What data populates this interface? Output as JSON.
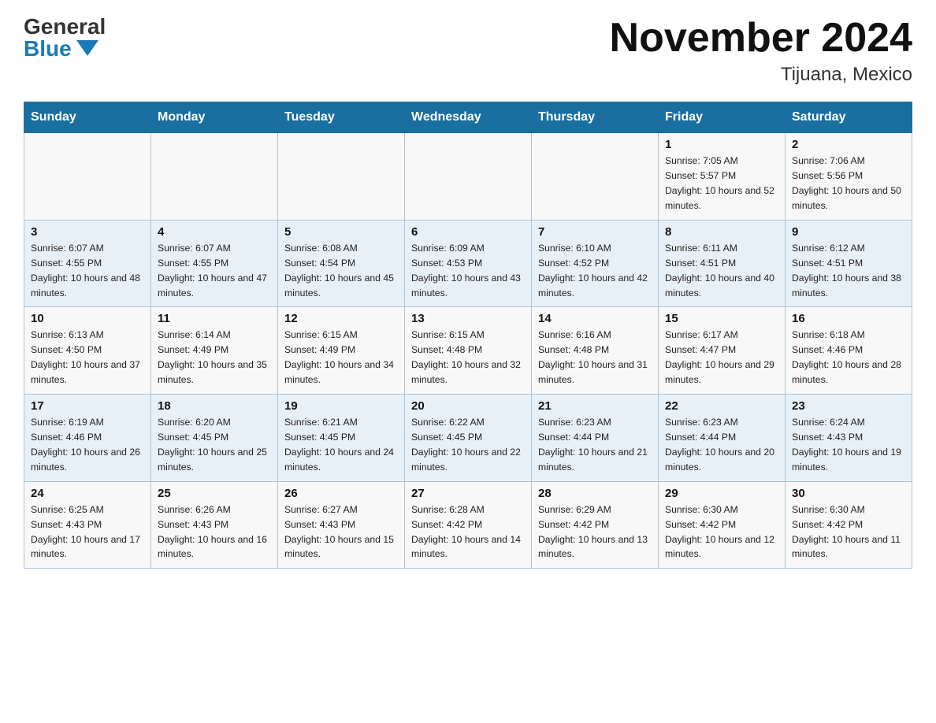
{
  "logo": {
    "general": "General",
    "blue": "Blue"
  },
  "header": {
    "month_year": "November 2024",
    "location": "Tijuana, Mexico"
  },
  "weekdays": [
    "Sunday",
    "Monday",
    "Tuesday",
    "Wednesday",
    "Thursday",
    "Friday",
    "Saturday"
  ],
  "weeks": [
    [
      {
        "day": "",
        "info": ""
      },
      {
        "day": "",
        "info": ""
      },
      {
        "day": "",
        "info": ""
      },
      {
        "day": "",
        "info": ""
      },
      {
        "day": "",
        "info": ""
      },
      {
        "day": "1",
        "info": "Sunrise: 7:05 AM\nSunset: 5:57 PM\nDaylight: 10 hours and 52 minutes."
      },
      {
        "day": "2",
        "info": "Sunrise: 7:06 AM\nSunset: 5:56 PM\nDaylight: 10 hours and 50 minutes."
      }
    ],
    [
      {
        "day": "3",
        "info": "Sunrise: 6:07 AM\nSunset: 4:55 PM\nDaylight: 10 hours and 48 minutes."
      },
      {
        "day": "4",
        "info": "Sunrise: 6:07 AM\nSunset: 4:55 PM\nDaylight: 10 hours and 47 minutes."
      },
      {
        "day": "5",
        "info": "Sunrise: 6:08 AM\nSunset: 4:54 PM\nDaylight: 10 hours and 45 minutes."
      },
      {
        "day": "6",
        "info": "Sunrise: 6:09 AM\nSunset: 4:53 PM\nDaylight: 10 hours and 43 minutes."
      },
      {
        "day": "7",
        "info": "Sunrise: 6:10 AM\nSunset: 4:52 PM\nDaylight: 10 hours and 42 minutes."
      },
      {
        "day": "8",
        "info": "Sunrise: 6:11 AM\nSunset: 4:51 PM\nDaylight: 10 hours and 40 minutes."
      },
      {
        "day": "9",
        "info": "Sunrise: 6:12 AM\nSunset: 4:51 PM\nDaylight: 10 hours and 38 minutes."
      }
    ],
    [
      {
        "day": "10",
        "info": "Sunrise: 6:13 AM\nSunset: 4:50 PM\nDaylight: 10 hours and 37 minutes."
      },
      {
        "day": "11",
        "info": "Sunrise: 6:14 AM\nSunset: 4:49 PM\nDaylight: 10 hours and 35 minutes."
      },
      {
        "day": "12",
        "info": "Sunrise: 6:15 AM\nSunset: 4:49 PM\nDaylight: 10 hours and 34 minutes."
      },
      {
        "day": "13",
        "info": "Sunrise: 6:15 AM\nSunset: 4:48 PM\nDaylight: 10 hours and 32 minutes."
      },
      {
        "day": "14",
        "info": "Sunrise: 6:16 AM\nSunset: 4:48 PM\nDaylight: 10 hours and 31 minutes."
      },
      {
        "day": "15",
        "info": "Sunrise: 6:17 AM\nSunset: 4:47 PM\nDaylight: 10 hours and 29 minutes."
      },
      {
        "day": "16",
        "info": "Sunrise: 6:18 AM\nSunset: 4:46 PM\nDaylight: 10 hours and 28 minutes."
      }
    ],
    [
      {
        "day": "17",
        "info": "Sunrise: 6:19 AM\nSunset: 4:46 PM\nDaylight: 10 hours and 26 minutes."
      },
      {
        "day": "18",
        "info": "Sunrise: 6:20 AM\nSunset: 4:45 PM\nDaylight: 10 hours and 25 minutes."
      },
      {
        "day": "19",
        "info": "Sunrise: 6:21 AM\nSunset: 4:45 PM\nDaylight: 10 hours and 24 minutes."
      },
      {
        "day": "20",
        "info": "Sunrise: 6:22 AM\nSunset: 4:45 PM\nDaylight: 10 hours and 22 minutes."
      },
      {
        "day": "21",
        "info": "Sunrise: 6:23 AM\nSunset: 4:44 PM\nDaylight: 10 hours and 21 minutes."
      },
      {
        "day": "22",
        "info": "Sunrise: 6:23 AM\nSunset: 4:44 PM\nDaylight: 10 hours and 20 minutes."
      },
      {
        "day": "23",
        "info": "Sunrise: 6:24 AM\nSunset: 4:43 PM\nDaylight: 10 hours and 19 minutes."
      }
    ],
    [
      {
        "day": "24",
        "info": "Sunrise: 6:25 AM\nSunset: 4:43 PM\nDaylight: 10 hours and 17 minutes."
      },
      {
        "day": "25",
        "info": "Sunrise: 6:26 AM\nSunset: 4:43 PM\nDaylight: 10 hours and 16 minutes."
      },
      {
        "day": "26",
        "info": "Sunrise: 6:27 AM\nSunset: 4:43 PM\nDaylight: 10 hours and 15 minutes."
      },
      {
        "day": "27",
        "info": "Sunrise: 6:28 AM\nSunset: 4:42 PM\nDaylight: 10 hours and 14 minutes."
      },
      {
        "day": "28",
        "info": "Sunrise: 6:29 AM\nSunset: 4:42 PM\nDaylight: 10 hours and 13 minutes."
      },
      {
        "day": "29",
        "info": "Sunrise: 6:30 AM\nSunset: 4:42 PM\nDaylight: 10 hours and 12 minutes."
      },
      {
        "day": "30",
        "info": "Sunrise: 6:30 AM\nSunset: 4:42 PM\nDaylight: 10 hours and 11 minutes."
      }
    ]
  ]
}
